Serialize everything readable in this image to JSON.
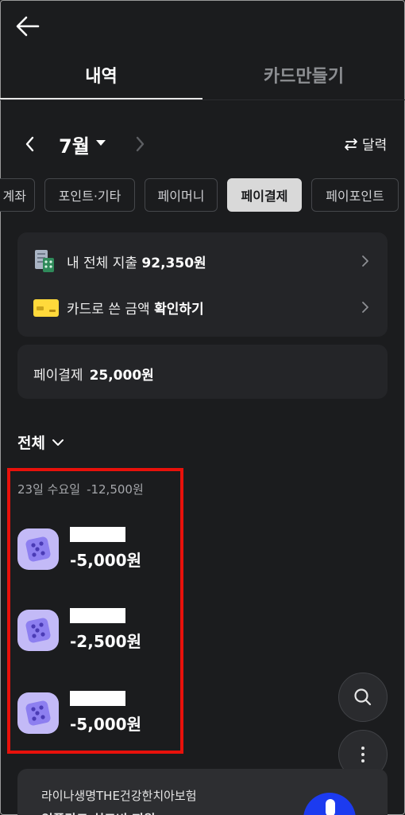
{
  "header": {
    "back_icon": "arrow-left-icon"
  },
  "tabs": [
    {
      "label": "내역",
      "active": true
    },
    {
      "label": "카드만들기",
      "active": false
    }
  ],
  "month_nav": {
    "month": "7월",
    "calendar_label": "달력"
  },
  "chips": [
    {
      "label": "계좌",
      "selected": false
    },
    {
      "label": "포인트·기타",
      "selected": false
    },
    {
      "label": "페이머니",
      "selected": false
    },
    {
      "label": "페이결제",
      "selected": true
    },
    {
      "label": "페이포인트",
      "selected": false
    }
  ],
  "summary": {
    "total_spend_prefix": "내 전체 지출",
    "total_spend_amount": "92,350원",
    "card_check_prefix": "카드로 쓴 금액",
    "card_check_action": "확인하기"
  },
  "pay_total": {
    "label": "페이결제",
    "amount": "25,000원"
  },
  "filter": {
    "label": "전체"
  },
  "day_group": {
    "date": "23일 수요일",
    "sum": "-12,500원",
    "transactions": [
      {
        "amount": "-5,000원",
        "icon": "dice-icon"
      },
      {
        "amount": "-2,500원",
        "icon": "dice-icon"
      },
      {
        "amount": "-5,000원",
        "icon": "dice-icon"
      }
    ]
  },
  "ad": {
    "title": "라이나생명THE건강한치아보험",
    "subtitle": "임플란트 치료비 지원"
  },
  "colors": {
    "background": "#1b1c1e",
    "card": "#242528",
    "selected_chip": "#d9d9d9",
    "highlight": "#e8110b",
    "dice": "#c3baf7"
  }
}
